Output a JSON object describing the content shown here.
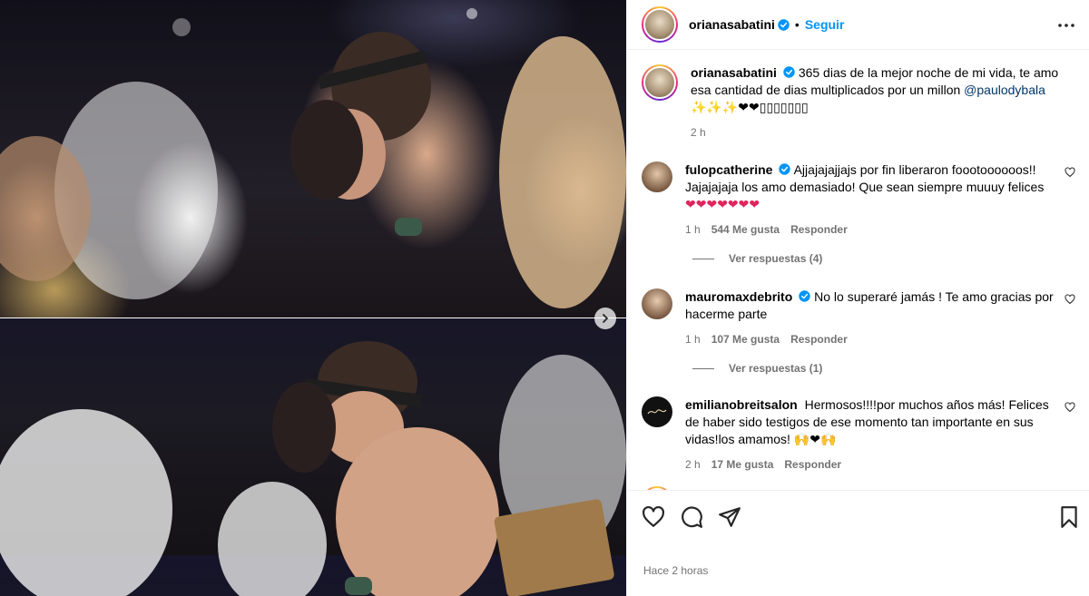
{
  "post": {
    "username": "orianasabatini",
    "follow_label": "Seguir",
    "separator": "•",
    "caption": {
      "username": "orianasabatini",
      "text": "365 dias de la mejor noche de mi vida, te amo esa cantidad de dias multiplicados por un millon",
      "mention": "@paulodybala",
      "emojis": "✨✨✨❤❤▯▯▯▯▯▯▯",
      "time": "2 h"
    },
    "timestamp": "Hace 2 horas"
  },
  "comments": [
    {
      "username": "fulopcatherine",
      "text": "Ajjajajajjajs por fin liberaron foootoooooos!! Jajajajaja los amo demasiado! Que sean siempre muuuy felices",
      "emojis": "❤❤❤❤❤❤❤",
      "time": "1 h",
      "likes": "544 Me gusta",
      "reply_label": "Responder",
      "view_replies": "Ver respuestas (4)"
    },
    {
      "username": "mauromaxdebrito",
      "text": "No lo superaré jamás ! Te amo gracias por hacerme parte",
      "time": "1 h",
      "likes": "107 Me gusta",
      "reply_label": "Responder",
      "view_replies": "Ver respuestas (1)"
    },
    {
      "username": "emilianobreitsalon",
      "text": "Hermosos!!!!por muchos años más! Felices de haber sido testigos de ese momento tan importante en sus vidas!los amamos!",
      "emojis": "🙌❤🙌",
      "time": "2 h",
      "likes": "17 Me gusta",
      "reply_label": "Responder"
    }
  ],
  "icons": {
    "verified": "verified-badge-icon",
    "more": "more-options-icon",
    "like": "heart-icon",
    "comment": "comment-icon",
    "share": "paper-plane-icon",
    "save": "bookmark-icon",
    "next": "chevron-right-icon"
  },
  "colors": {
    "accent": "#0095f6",
    "verified": "#0095f6",
    "secondary_text": "#737373",
    "mention": "#00376b",
    "heart": "#e0245e"
  }
}
